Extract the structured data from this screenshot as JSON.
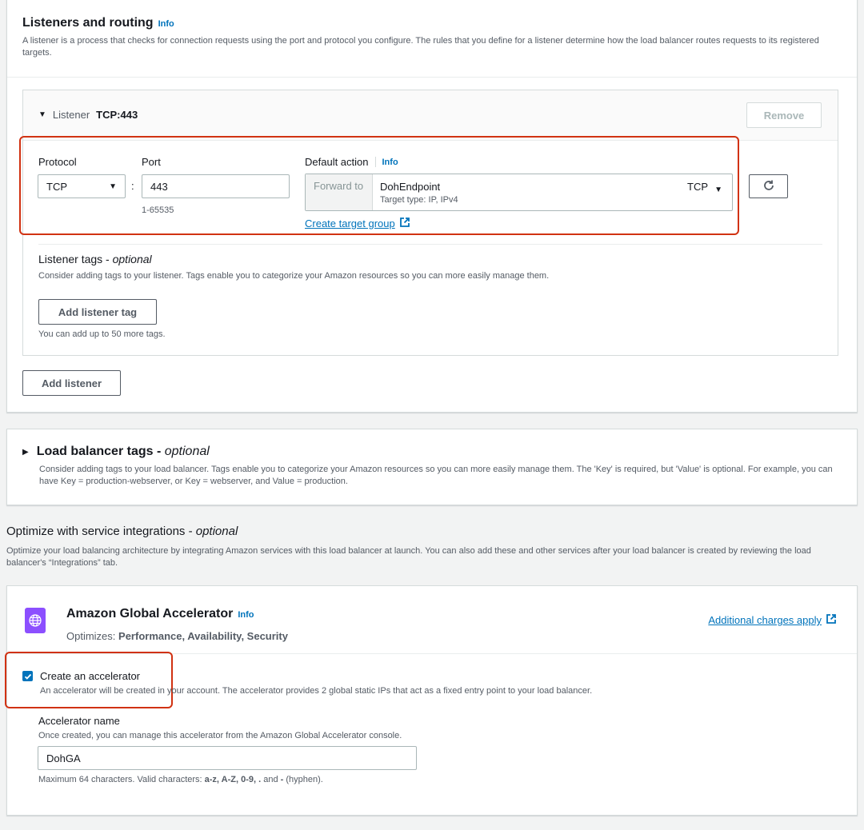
{
  "listeners": {
    "title": "Listeners and routing",
    "info": "Info",
    "description": "A listener is a process that checks for connection requests using the port and protocol you configure. The rules that you define for a listener determine how the load balancer routes requests to its registered targets.",
    "listener": {
      "label": "Listener",
      "name": "TCP:443",
      "remove": "Remove",
      "protocol_label": "Protocol",
      "protocol_value": "TCP",
      "colon": ":",
      "port_label": "Port",
      "port_value": "443",
      "port_hint": "1-65535",
      "default_action_label": "Default action",
      "default_action_info": "Info",
      "forward_to": "Forward to",
      "target_group": "DohEndpoint",
      "target_protocol": "TCP",
      "target_type": "Target type: IP, IPv4",
      "create_target_group": "Create target group",
      "tags_title": "Listener tags - ",
      "tags_optional": "optional",
      "tags_description": "Consider adding tags to your listener. Tags enable you to categorize your Amazon resources so you can more easily manage them.",
      "add_tag": "Add listener tag",
      "tags_hint": "You can add up to 50 more tags."
    },
    "add_listener": "Add listener"
  },
  "lb_tags": {
    "title": "Load balancer tags - ",
    "optional": "optional",
    "description": "Consider adding tags to your load balancer. Tags enable you to categorize your Amazon resources so you can more easily manage them. The 'Key' is required, but 'Value' is optional. For example, you can have Key = production-webserver, or Key = webserver, and Value = production."
  },
  "integrations": {
    "title": "Optimize with service integrations - ",
    "optional": "optional",
    "description": "Optimize your load balancing architecture by integrating Amazon services with this load balancer at launch. You can also add these and other services after your load balancer is created by reviewing the load balancer's “Integrations” tab."
  },
  "accelerator": {
    "title": "Amazon Global Accelerator",
    "info": "Info",
    "optimizes_label": "Optimizes:",
    "optimizes_value": "Performance, Availability, Security",
    "charges_link": "Additional charges apply",
    "checkbox_label": "Create an accelerator",
    "checkbox_checked": true,
    "checkbox_description": "An accelerator will be created in your account. The accelerator provides 2 global static IPs that act as a fixed entry point to your load balancer.",
    "name_label": "Accelerator name",
    "name_description": "Once created, you can manage this accelerator from the Amazon Global Accelerator console.",
    "name_value": "DohGA",
    "hint_prefix": "Maximum 64 characters. Valid characters: ",
    "hint_chars": "a-z, A-Z, 0-9, .",
    "hint_and": " and ",
    "hint_dash": "-",
    "hint_suffix": " (hyphen)."
  },
  "colors": {
    "accent": "#0073bb",
    "highlight": "#d13212",
    "icon_bg": "#8c4fff"
  }
}
